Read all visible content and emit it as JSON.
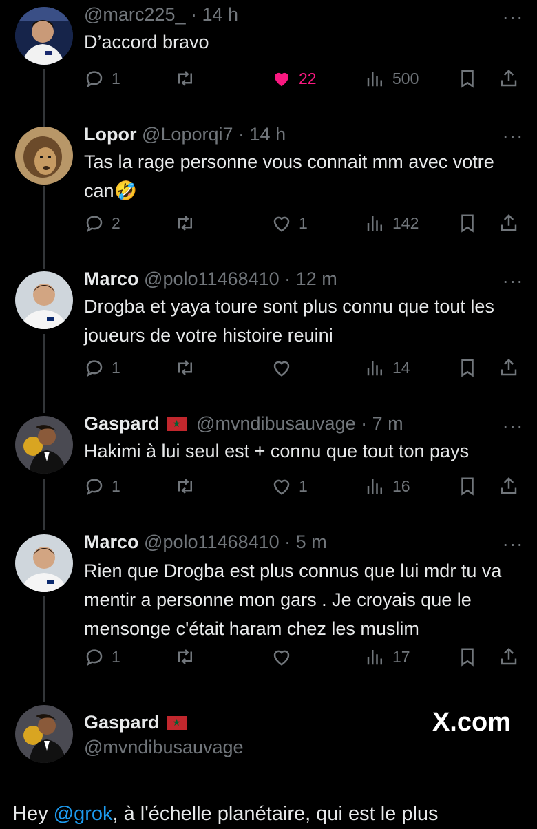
{
  "tweets": [
    {
      "name": "",
      "handle": "@marc225_",
      "time": "14 h",
      "text": "D’accord bravo",
      "replies": "1",
      "likes": "22",
      "views": "500",
      "liked": true
    },
    {
      "name": "Lopor",
      "handle": "@Loporqi7",
      "time": "14 h",
      "text": "Tas la rage personne vous connait mm avec votre can🤣",
      "replies": "2",
      "likes": "1",
      "views": "142",
      "liked": false
    },
    {
      "name": "Marco",
      "handle": "@polo11468410",
      "time": "12 m",
      "text": "Drogba et yaya toure sont plus connu que tout les joueurs de votre histoire reuini",
      "replies": "1",
      "likes": "",
      "views": "14",
      "liked": false
    },
    {
      "name": "Gaspard",
      "handle": "@mvndibusauvage",
      "time": "7 m",
      "text": "Hakimi à lui seul est + connu que tout ton pays",
      "replies": "1",
      "likes": "1",
      "views": "16",
      "liked": false
    },
    {
      "name": "Marco",
      "handle": "@polo11468410",
      "time": "5 m",
      "text": "Rien que Drogba est plus connus que lui mdr tu va mentir a personne mon gars . Je croyais que le mensonge c'était haram chez les muslim",
      "replies": "1",
      "likes": "",
      "views": "17",
      "liked": false
    }
  ],
  "main_post": {
    "name": "Gaspard",
    "handle": "@mvndibusauvage",
    "watermark": "X.com"
  },
  "bottom": {
    "prefix": "Hey ",
    "mention": "@grok",
    "suffix": ", à l'échelle planétaire, qui est le plus"
  },
  "separator": "·",
  "more": "···",
  "colors": {
    "background": "#000000",
    "text": "#e7e9ea",
    "muted": "#71767b",
    "like": "#f91880",
    "link": "#1d9bf0"
  }
}
